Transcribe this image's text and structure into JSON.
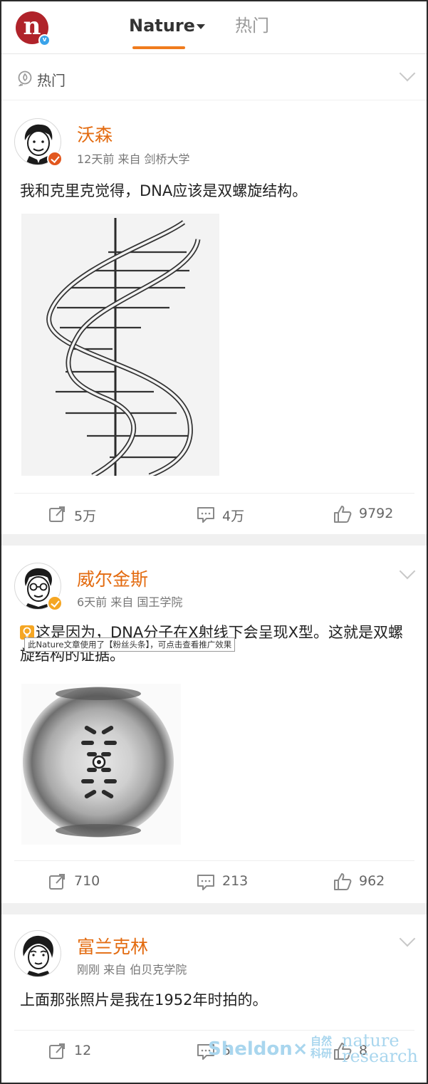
{
  "nav": {
    "logo_letter": "n",
    "tabs": [
      {
        "label": "Nature",
        "active": true
      },
      {
        "label": "热门",
        "active": false
      }
    ],
    "accent_color": "#f07c1e"
  },
  "hot_bar": {
    "label": "热门"
  },
  "posts": [
    {
      "author": "沃森",
      "time": "12天前",
      "source": "来自 剑桥大学",
      "text": "我和克里克觉得，DNA应该是双螺旋结构。",
      "image": "double-helix-drawing",
      "reposts": "5万",
      "comments": "4万",
      "likes": "9792"
    },
    {
      "author": "威尔金斯",
      "time": "6天前",
      "source": "来自 国王学院",
      "text": "这是因为，DNA分子在X射线下会呈现X型。这就是双螺旋结构的证据。",
      "ad_tooltip": "此Nature文章使用了【粉丝头条】，可点击查看推广效果",
      "image": "x-ray-diffraction-photo",
      "reposts": "710",
      "comments": "213",
      "likes": "962"
    },
    {
      "author": "富兰克林",
      "time": "刚刚",
      "source": "来自 伯贝克学院",
      "text": "上面那张照片是我在1952年时拍的。",
      "reposts": "12",
      "comments": "5",
      "likes": "8"
    }
  ],
  "watermark": {
    "sheldon": "Sheldon×",
    "cn": "自然科研",
    "nature": "nature research"
  }
}
